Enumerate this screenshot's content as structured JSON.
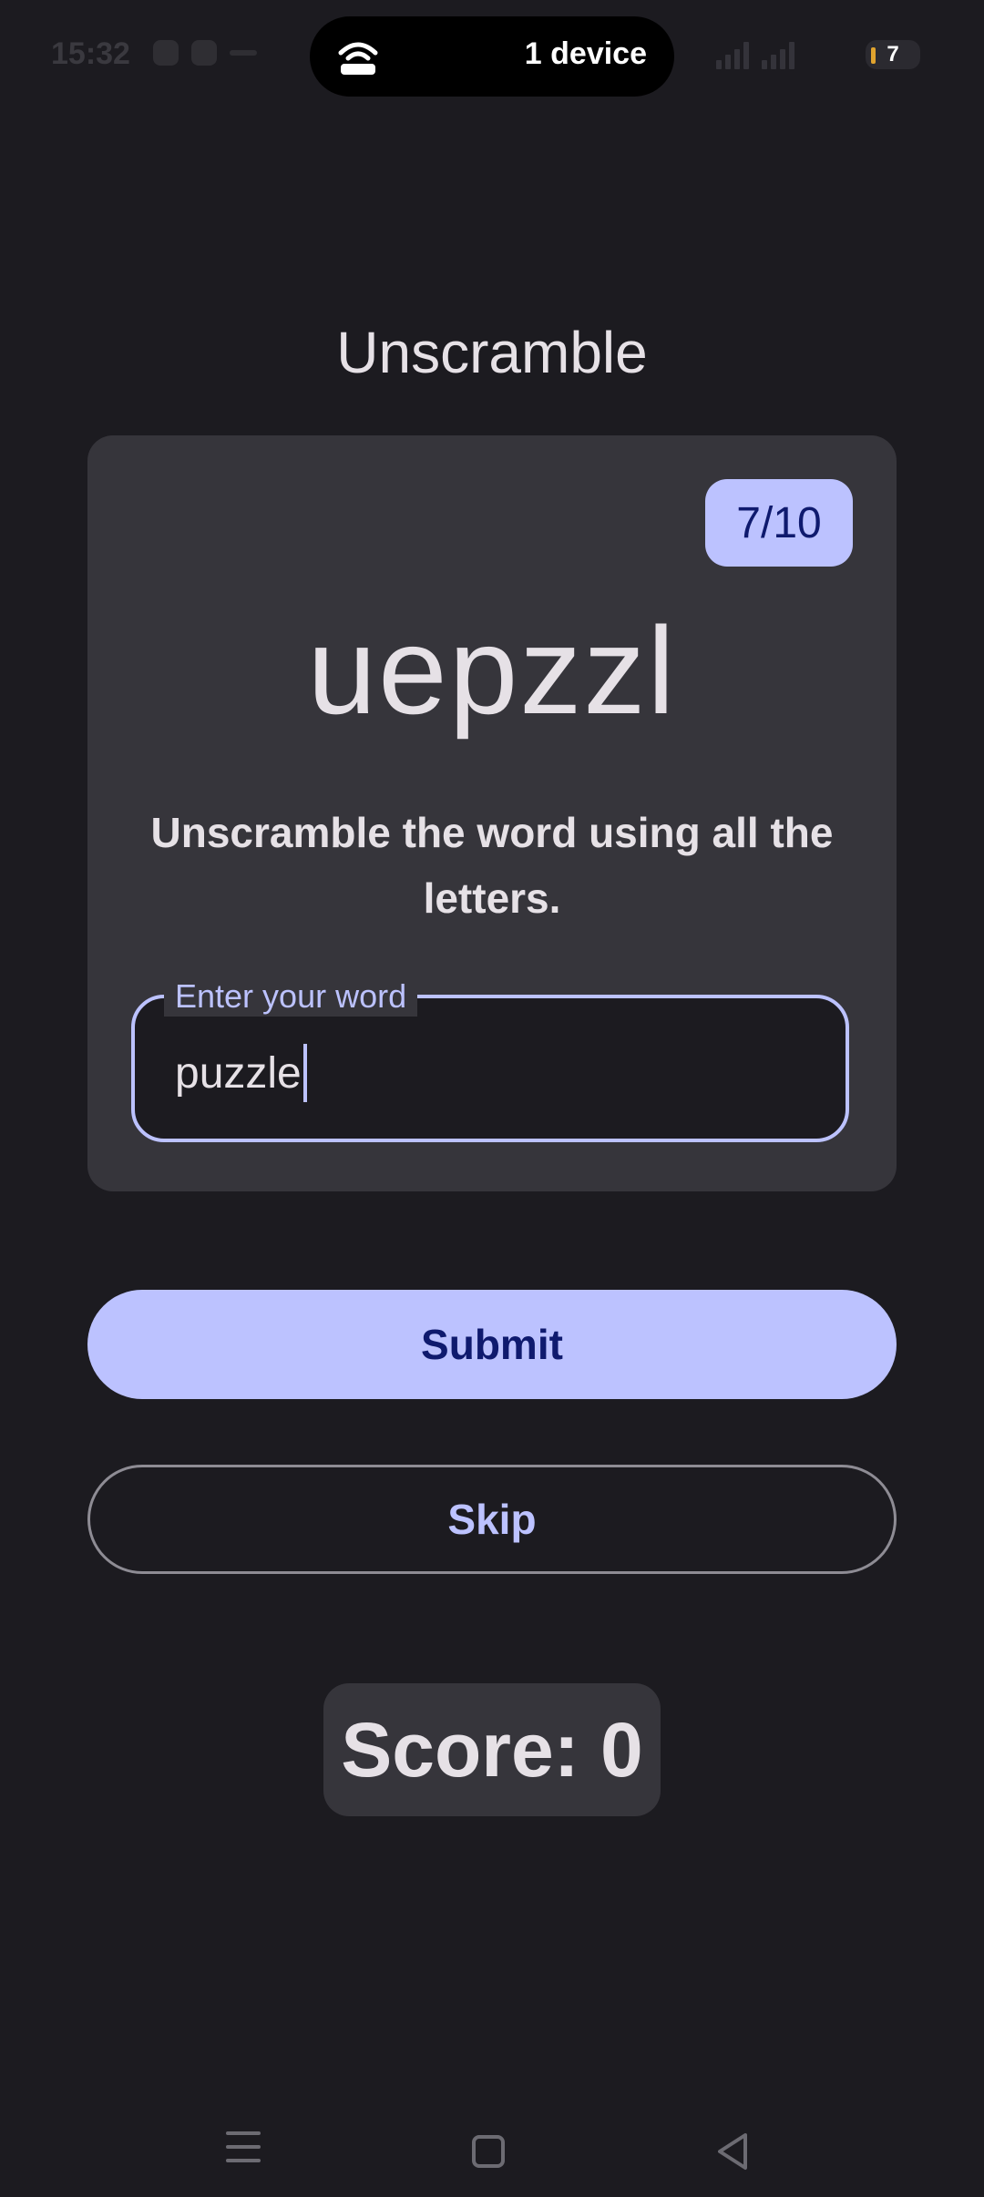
{
  "status_bar": {
    "time": "15:32",
    "pill_text": "1 device",
    "battery": "7"
  },
  "app": {
    "title": "Unscramble"
  },
  "card": {
    "counter": "7/10",
    "scrambled_word": "uepzzl",
    "instructions": "Unscramble the word using all the letters.",
    "input_label": "Enter your word",
    "input_value": "puzzle"
  },
  "actions": {
    "submit_label": "Submit",
    "skip_label": "Skip"
  },
  "score": {
    "text": "Score: 0"
  },
  "colors": {
    "background": "#1c1b20",
    "surface": "#36353b",
    "primary": "#bcc2ff",
    "on_primary": "#0f1a6e",
    "on_surface": "#e6e1e6"
  },
  "icons": {
    "pill_icon": "hotspot-icon",
    "nav_menu": "menu-icon",
    "nav_home": "home-icon",
    "nav_back": "back-icon"
  }
}
